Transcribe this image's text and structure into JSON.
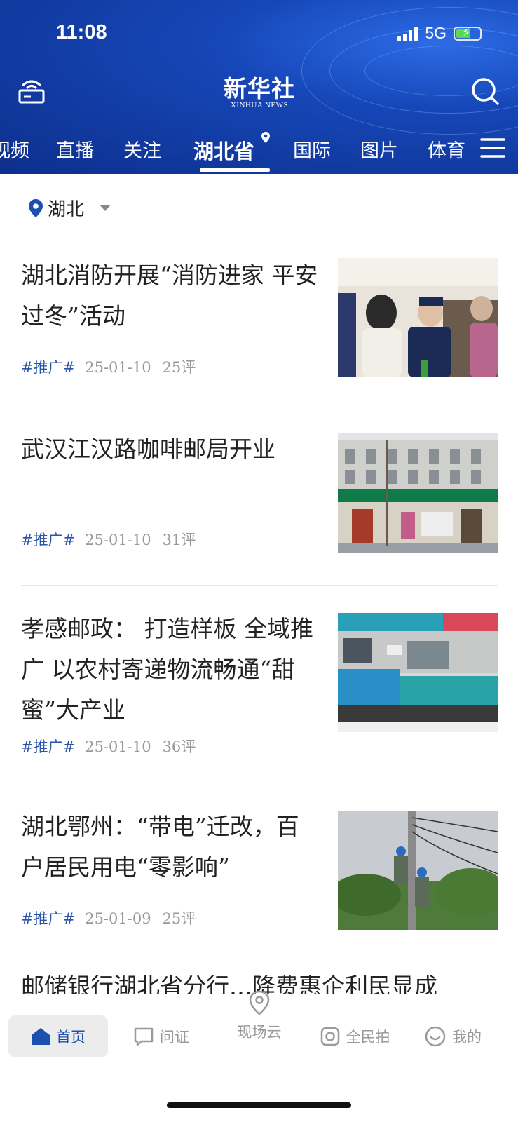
{
  "status": {
    "time": "11:08",
    "network": "5G"
  },
  "header": {
    "logo_cn": "新华社",
    "logo_en": "XINHUA NEWS",
    "tabs": [
      "视频",
      "直播",
      "关注",
      "湖北省",
      "国际",
      "图片",
      "体育"
    ],
    "active_tab": "湖北省"
  },
  "location": {
    "label": "湖北"
  },
  "articles": [
    {
      "title": "湖北消防开展“消防进家 平安过冬”活动",
      "tag": "#推广#",
      "date": "25-01-10",
      "comments": "25评"
    },
    {
      "title": "武汉江汉路咖啡邮局开业",
      "tag": "#推广#",
      "date": "25-01-10",
      "comments": "31评"
    },
    {
      "title": "孝感邮政： 打造样板 全域推广 以农村寄递物流畅通“甜蜜”大产业",
      "tag": "#推广#",
      "date": "25-01-10",
      "comments": "36评"
    },
    {
      "title": "湖北鄂州：“带电”迁改，百户居民用电“零影响”",
      "tag": "#推广#",
      "date": "25-01-09",
      "comments": "25评"
    }
  ],
  "partial_article": {
    "title": "邮储银行湖北省分行…降费惠企利民显成"
  },
  "bottom_nav": [
    {
      "label": "首页",
      "icon": "home-icon"
    },
    {
      "label": "问证",
      "icon": "chat-icon"
    },
    {
      "label": "现场云",
      "icon": "location-icon"
    },
    {
      "label": "全民拍",
      "icon": "camera-icon"
    },
    {
      "label": "我的",
      "icon": "smile-icon"
    }
  ],
  "colors": {
    "header_blue": "#1647b8",
    "accent": "#1d4fb0",
    "tag_blue": "#2a56a8"
  }
}
